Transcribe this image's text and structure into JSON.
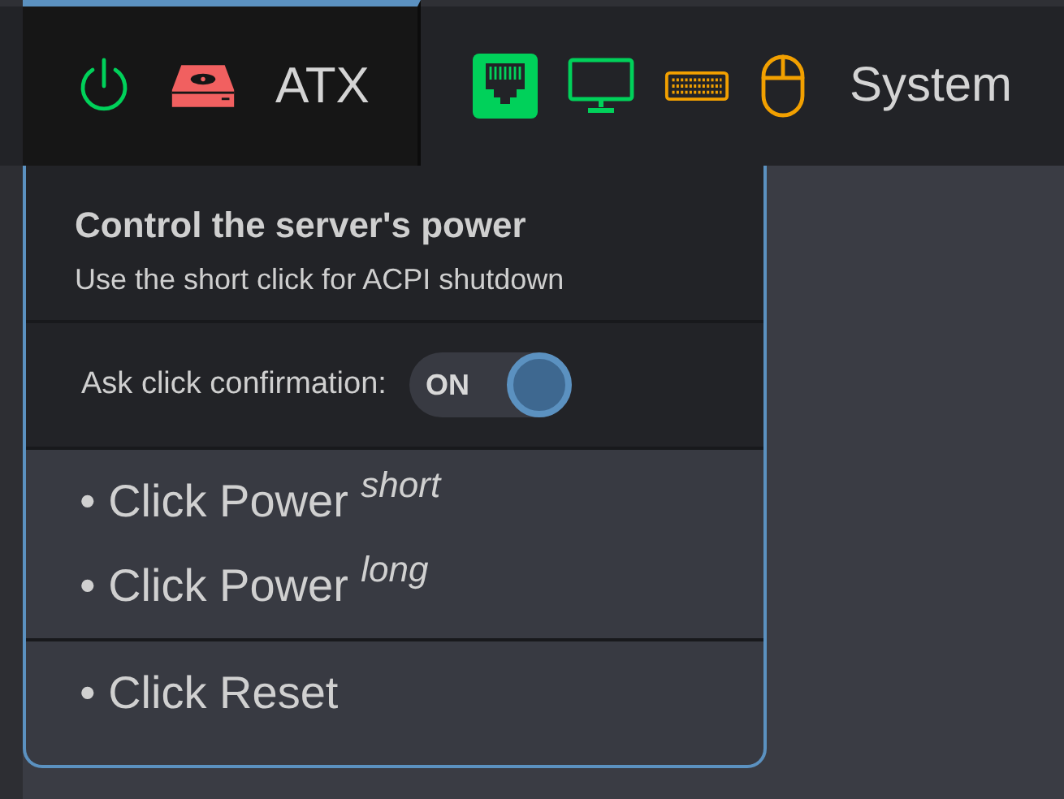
{
  "navbar": {
    "atx_tab": {
      "label": "ATX",
      "selected": true,
      "indicators": [
        {
          "kind": "power",
          "color": "#00d15a"
        },
        {
          "kind": "drive",
          "color": "#f16060"
        }
      ]
    },
    "indicators": [
      {
        "kind": "network",
        "color": "#00d15a"
      },
      {
        "kind": "monitor",
        "color": "#00d15a"
      },
      {
        "kind": "keyboard",
        "color": "#f2a000"
      },
      {
        "kind": "mouse",
        "color": "#f2a000"
      }
    ],
    "system_tab": {
      "label": "System"
    }
  },
  "atx_menu": {
    "title": "Control the server's power",
    "subtitle": "Use the short click for ACPI shutdown",
    "confirm": {
      "label": "Ask click confirmation:",
      "state_label": "ON",
      "on": true
    },
    "groups": [
      [
        {
          "label": "• Click Power",
          "mode": "short"
        },
        {
          "label": "• Click Power",
          "mode": "long"
        }
      ],
      [
        {
          "label": "• Click Reset"
        }
      ]
    ]
  }
}
